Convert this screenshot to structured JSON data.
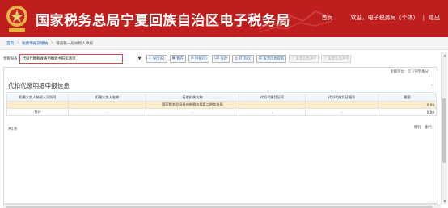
{
  "header": {
    "title": "国家税务总局宁夏回族自治区电子税务局",
    "nav_home": "首页",
    "nav_welcome": "欢迎，",
    "nav_user": "电子税务局（个体）",
    "nav_separator": "|",
    "nav_logout": "退出"
  },
  "breadcrumb": {
    "items": [
      "首页",
      "税费申报及缴纳",
      "增值税一般纳税人申报"
    ],
    "separator": ">"
  },
  "toolbar": {
    "label": "金税报表",
    "select_value": "代扣代缴税收通用缴款书抵扣清单",
    "buttons": [
      {
        "icon": "⇩",
        "label": "导出(E)",
        "disabled": false
      },
      {
        "icon": "▣",
        "label": "暂存",
        "disabled": false
      },
      {
        "icon": "✉",
        "label": "申报(S)",
        "disabled": false
      },
      {
        "icon": "⌫",
        "label": "作废",
        "disabled": false
      },
      {
        "icon": "⎙",
        "label": "打印(D)",
        "disabled": false
      },
      {
        "icon": "▤",
        "label": "发票信息提取",
        "disabled": false
      },
      {
        "icon": "↺",
        "label": "发票信息清空",
        "disabled": true
      },
      {
        "icon": "↺",
        "label": "发票信息清空",
        "disabled": true
      }
    ]
  },
  "content": {
    "unit": "金额单位：元（列至角分）",
    "section_title": "代扣代缴明细申报信息",
    "columns": [
      "扣缴义务人纳税人识别号",
      "扣缴义务人名称",
      "征收机关名称",
      "代扣代缴凭证号",
      "代扣代缴凭证编号",
      "税额"
    ],
    "rows": [
      {
        "taxpayer_id": "",
        "name": "",
        "authority": "国家税务总局贵州市税务局第二税务分局",
        "cert_no": "",
        "cert_code": "",
        "tax": "0.00"
      }
    ],
    "total": {
      "label": "合计",
      "values": [
        "-",
        "-",
        "-",
        "-",
        "0.00"
      ]
    },
    "count": "共1条",
    "pager": [
      "增行",
      "删行"
    ]
  },
  "colors": {
    "header_bg": "#bf1e1e",
    "highlight_row": "#fbedc9",
    "select_border": "#e04848",
    "link": "#2a6ebf"
  }
}
